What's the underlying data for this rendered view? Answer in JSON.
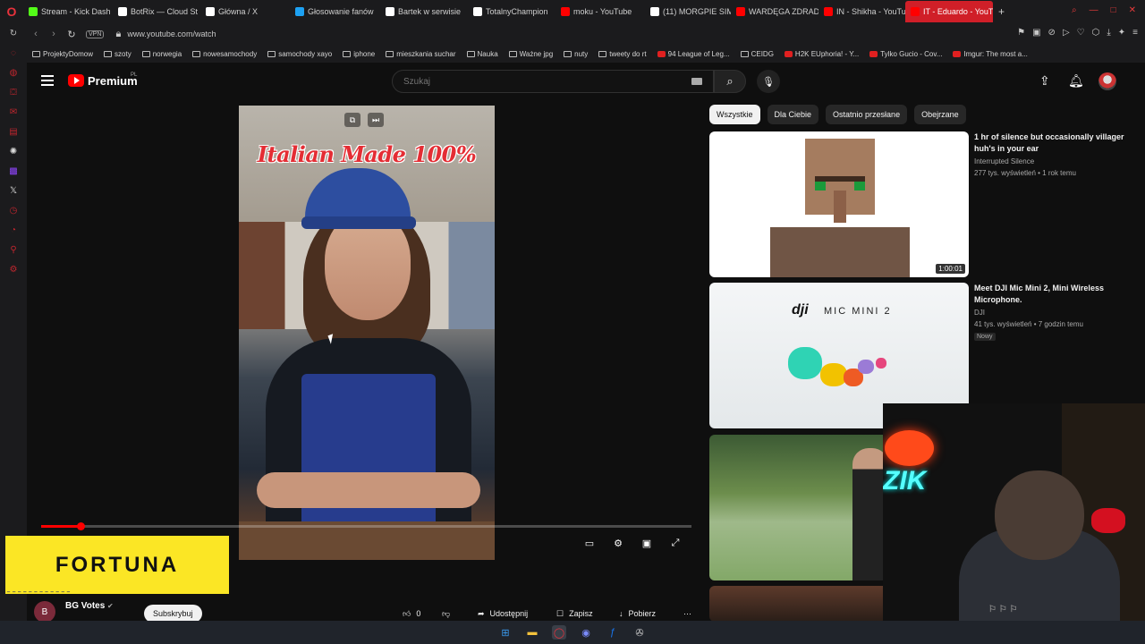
{
  "browser": {
    "tabs": [
      {
        "label": "Stream - Kick Dash",
        "icon": "kick-icon",
        "color": "#53fc18"
      },
      {
        "label": "BotRix — Cloud St",
        "icon": "botrix-icon",
        "color": "#ffffff"
      },
      {
        "label": "Główna / X",
        "icon": "x-icon",
        "color": "#ffffff"
      },
      {
        "label": "Głosowanie fanów",
        "icon": "poll-icon",
        "color": "#1da1f2"
      },
      {
        "label": "Bartek w serwisie",
        "icon": "x-icon",
        "color": "#ffffff"
      },
      {
        "label": "TotalnyChampion",
        "icon": "x-icon",
        "color": "#ffffff"
      },
      {
        "label": "moku - YouTube",
        "icon": "youtube-icon",
        "color": "#ff0000"
      },
      {
        "label": "(11) MORGPIE SIM",
        "icon": "x-icon",
        "color": "#ffffff"
      },
      {
        "label": "WARDĘGA ZDRAD",
        "icon": "youtube-icon",
        "color": "#ff0000"
      },
      {
        "label": "IN - Shikha - YouTu",
        "icon": "youtube-icon",
        "color": "#ff0000"
      },
      {
        "label": "IT - Eduardo - YouTube",
        "icon": "youtube-icon",
        "color": "#ff0000",
        "active": true
      }
    ],
    "url": "www.youtube.com/watch",
    "vpn_label": "VPN",
    "bookmarks": [
      {
        "label": "ProjektyDomow"
      },
      {
        "label": "szoty"
      },
      {
        "label": "norwegia"
      },
      {
        "label": "nowesamochody"
      },
      {
        "label": "samochody xayo"
      },
      {
        "label": "iphone"
      },
      {
        "label": "mieszkania suchar"
      },
      {
        "label": "Nauka"
      },
      {
        "label": "Ważne jpg"
      },
      {
        "label": "nuty"
      },
      {
        "label": "tweety do rt"
      },
      {
        "label": "94 League of Leg..."
      },
      {
        "label": "CEIDG"
      },
      {
        "label": "H2K EUphoria! - Y..."
      },
      {
        "label": "Tylko Gucio - Cov..."
      },
      {
        "label": "Imgur: The most a..."
      }
    ]
  },
  "youtube": {
    "logo_text": "Premium",
    "logo_region": "PL",
    "search_placeholder": "Szukaj",
    "video_overlay_title": "Italian Made 100%",
    "filters": [
      "Wszystkie",
      "Dla Ciebie",
      "Ostatnio przesłane",
      "Obejrzane"
    ],
    "progress": 0.06,
    "channel": {
      "avatar_letter": "B",
      "name": "BG Votes",
      "subscribe_label": "Subskrybuj"
    },
    "actions": {
      "likes": "0",
      "share": "Udostępnij",
      "save": "Zapisz",
      "download": "Pobierz"
    },
    "recommendations": [
      {
        "title": "1 hr of silence but occasionally villager huh's in your ear",
        "channel": "Interrupted Silence",
        "meta": "277 tys. wyświetleń • 1 rok temu",
        "duration": "1:00:01"
      },
      {
        "title": "Meet DJI Mic Mini 2, Mini Wireless Microphone.",
        "channel": "DJI",
        "meta": "41 tys. wyświetleń • 7 godzin temu",
        "badge": "Nowy",
        "thumb_logo": "dji",
        "thumb_text": "MIC MINI 2"
      }
    ]
  },
  "overlay": {
    "sponsor": "FORTUNA",
    "neon_text": "ZIK"
  }
}
